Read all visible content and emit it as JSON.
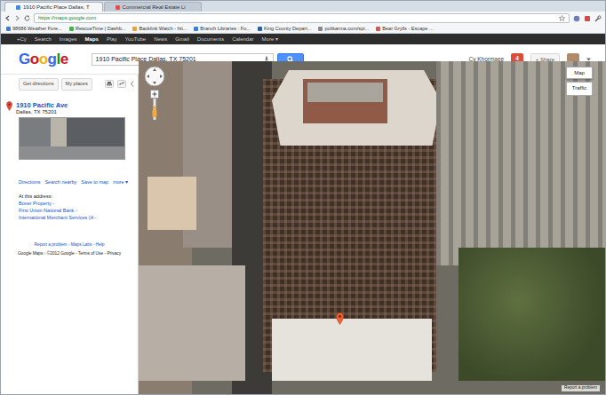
{
  "browser": {
    "tabs": [
      {
        "label": "1910 Pacific Place Dallas, T",
        "selected": true
      },
      {
        "label": "Commercial Real Estate Li",
        "selected": false
      }
    ],
    "url": "https://maps.google.com",
    "bookmarks": [
      "98686 Weather Fore...",
      "RescueTime | Dashb...",
      "Backlink Watch - htt...",
      "Branch Libraries : Fo...",
      "King County Depart...",
      "polikarma.com/spi...",
      "Bear Grylls - Escape ..."
    ]
  },
  "google_bar": [
    {
      "label": "+Cy",
      "selected": false
    },
    {
      "label": "Search",
      "selected": false
    },
    {
      "label": "Images",
      "selected": false
    },
    {
      "label": "Maps",
      "selected": true
    },
    {
      "label": "Play",
      "selected": false
    },
    {
      "label": "YouTube",
      "selected": false
    },
    {
      "label": "News",
      "selected": false
    },
    {
      "label": "Gmail",
      "selected": false
    },
    {
      "label": "Documents",
      "selected": false
    },
    {
      "label": "Calendar",
      "selected": false
    },
    {
      "label": "More ▾",
      "selected": false
    }
  ],
  "header": {
    "logo": "Google",
    "search": "1910 Pacific Place Dallas, TX 75201",
    "user": "Cy Khormaee",
    "notifications": "4",
    "share": "+ Share"
  },
  "toolbar": [
    "Get directions",
    "My places"
  ],
  "place": {
    "title": "1910 Pacific Ave",
    "address": "Dallas, TX 75201",
    "actions": [
      "Directions",
      "Search nearby",
      "Save to map",
      "more ▾"
    ],
    "at_address_label": "At this address:",
    "businesses": [
      "Boxer Property -",
      "First Union National Bank -",
      "International Merchant Services (A -"
    ]
  },
  "footer": [
    "Report a problem - Maps Labs - Help",
    "Google Maps - ©2012 Google - Terms of Use - Privacy"
  ],
  "map": {
    "type_button": "Map",
    "traffic": "Traffic",
    "report": "Report a problem"
  }
}
